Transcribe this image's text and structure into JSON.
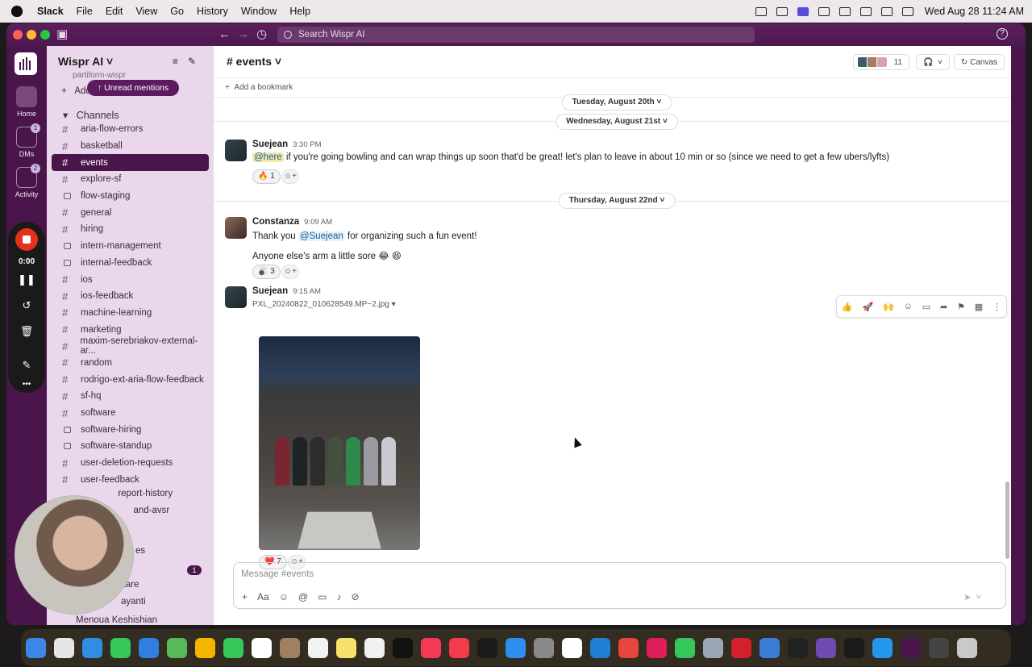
{
  "menubar": {
    "app": "Slack",
    "items": [
      "File",
      "Edit",
      "View",
      "Go",
      "History",
      "Window",
      "Help"
    ],
    "datetime": "Wed Aug 28  11:24 AM"
  },
  "titlebar": {
    "search_placeholder": "Search Wispr AI"
  },
  "rail": {
    "home": "Home",
    "dms": "DMs",
    "dms_badge": "1",
    "activity": "Activity",
    "activity_badge": "2",
    "recorder_time": "0:00"
  },
  "sidebar": {
    "workspace": "Wispr AI",
    "unread_mentions": "Unread mentions",
    "partial_above": "partiform-wispr",
    "add_label": "Add",
    "channels_header": "Channels",
    "channels": [
      {
        "name": "aria-flow-errors",
        "private": false
      },
      {
        "name": "basketball",
        "private": false
      },
      {
        "name": "events",
        "private": false,
        "active": true
      },
      {
        "name": "explore-sf",
        "private": false
      },
      {
        "name": "flow-staging",
        "private": true
      },
      {
        "name": "general",
        "private": false
      },
      {
        "name": "hiring",
        "private": false
      },
      {
        "name": "intern-management",
        "private": true
      },
      {
        "name": "internal-feedback",
        "private": true
      },
      {
        "name": "ios",
        "private": false
      },
      {
        "name": "ios-feedback",
        "private": false
      },
      {
        "name": "machine-learning",
        "private": false
      },
      {
        "name": "marketing",
        "private": false
      },
      {
        "name": "maxim-serebriakov-external-ar...",
        "private": false
      },
      {
        "name": "random",
        "private": false
      },
      {
        "name": "rodrigo-ext-aria-flow-feedback",
        "private": false
      },
      {
        "name": "sf-hq",
        "private": false
      },
      {
        "name": "software",
        "private": false
      },
      {
        "name": "software-hiring",
        "private": true
      },
      {
        "name": "software-standup",
        "private": true
      },
      {
        "name": "user-deletion-requests",
        "private": false
      },
      {
        "name": "user-feedback",
        "private": false
      }
    ],
    "partial_items": [
      "report-history",
      "and-avsr",
      "es",
      "kare",
      "ayanti"
    ],
    "dm_badge": "1",
    "last_dm": "Menoua Keshishian"
  },
  "channel": {
    "title": "# events",
    "member_count": "11",
    "canvas_label": "Canvas",
    "add_bookmark": "Add a bookmark"
  },
  "dates": {
    "d1": "Tuesday, August 20th",
    "d2": "Wednesday, August 21st",
    "d3": "Thursday, August 22nd"
  },
  "messages": [
    {
      "author": "Suejean",
      "time": "3:30 PM",
      "mention": "@here",
      "text": "if you're going bowling and can wrap things up soon that'd be great! let's plan to leave in about 10 min or so (since we need to get a few ubers/lyfts)",
      "reaction": "🔥 1"
    },
    {
      "author": "Constanza",
      "time": "9:09 AM",
      "text_a": "Thank you",
      "link": "@Suejean",
      "text_b": "for organizing such a fun event!",
      "line2": "Anyone else's arm a little sore 😂 😆",
      "reaction": "🎳 3"
    },
    {
      "author": "Suejean",
      "time": "9:15 AM",
      "file": "PXL_20240822_010628549.MP~2.jpg",
      "reaction": "❤️ 7"
    }
  ],
  "composer": {
    "placeholder": "Message #events"
  },
  "colors": {
    "aubergine": "#4a154b",
    "sidebar": "#ead7eb",
    "mention_bg": "#f6e7a8",
    "record": "#e4311c"
  }
}
